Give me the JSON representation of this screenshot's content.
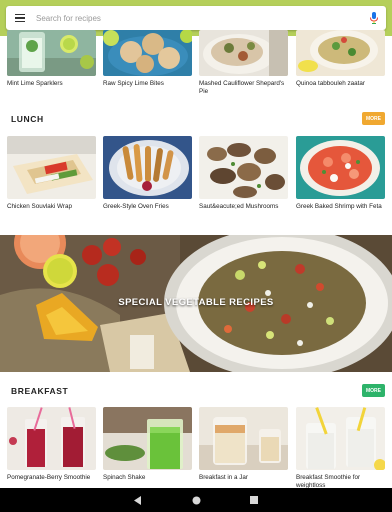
{
  "search": {
    "placeholder": "Search for recipes"
  },
  "top_row": [
    {
      "title": "Mint Lime Sparklers"
    },
    {
      "title": "Raw Spicy Lime Bites"
    },
    {
      "title": "Mashed Cauliflower Shepard's Pie"
    },
    {
      "title": "Quinoa tabbouleh zaatar"
    }
  ],
  "lunch": {
    "title": "LUNCH",
    "more_label": "MORE",
    "more_color": "#f0a830",
    "items": [
      {
        "title": "Chicken Souvlaki Wrap"
      },
      {
        "title": "Greek-Style Oven Fries"
      },
      {
        "title": "Saut&eacute;ed Mushrooms"
      },
      {
        "title": "Greek Baked Shrimp with Feta"
      }
    ]
  },
  "banner": {
    "title": "SPECIAL VEGETABLE RECIPES"
  },
  "breakfast": {
    "title": "BREAKFAST",
    "more_label": "MORE",
    "more_color": "#2db36a",
    "items": [
      {
        "title": "Pomegranate-Berry Smoothie"
      },
      {
        "title": "Spinach Shake"
      },
      {
        "title": "Breakfast in a Jar"
      },
      {
        "title": "Breakfast Smoothie for weightloss"
      }
    ]
  },
  "colors": {
    "header": "#b5cf5a",
    "navbar": "#000000"
  },
  "icons": [
    "menu-icon",
    "mic-icon",
    "back-icon",
    "home-icon",
    "recents-icon"
  ]
}
